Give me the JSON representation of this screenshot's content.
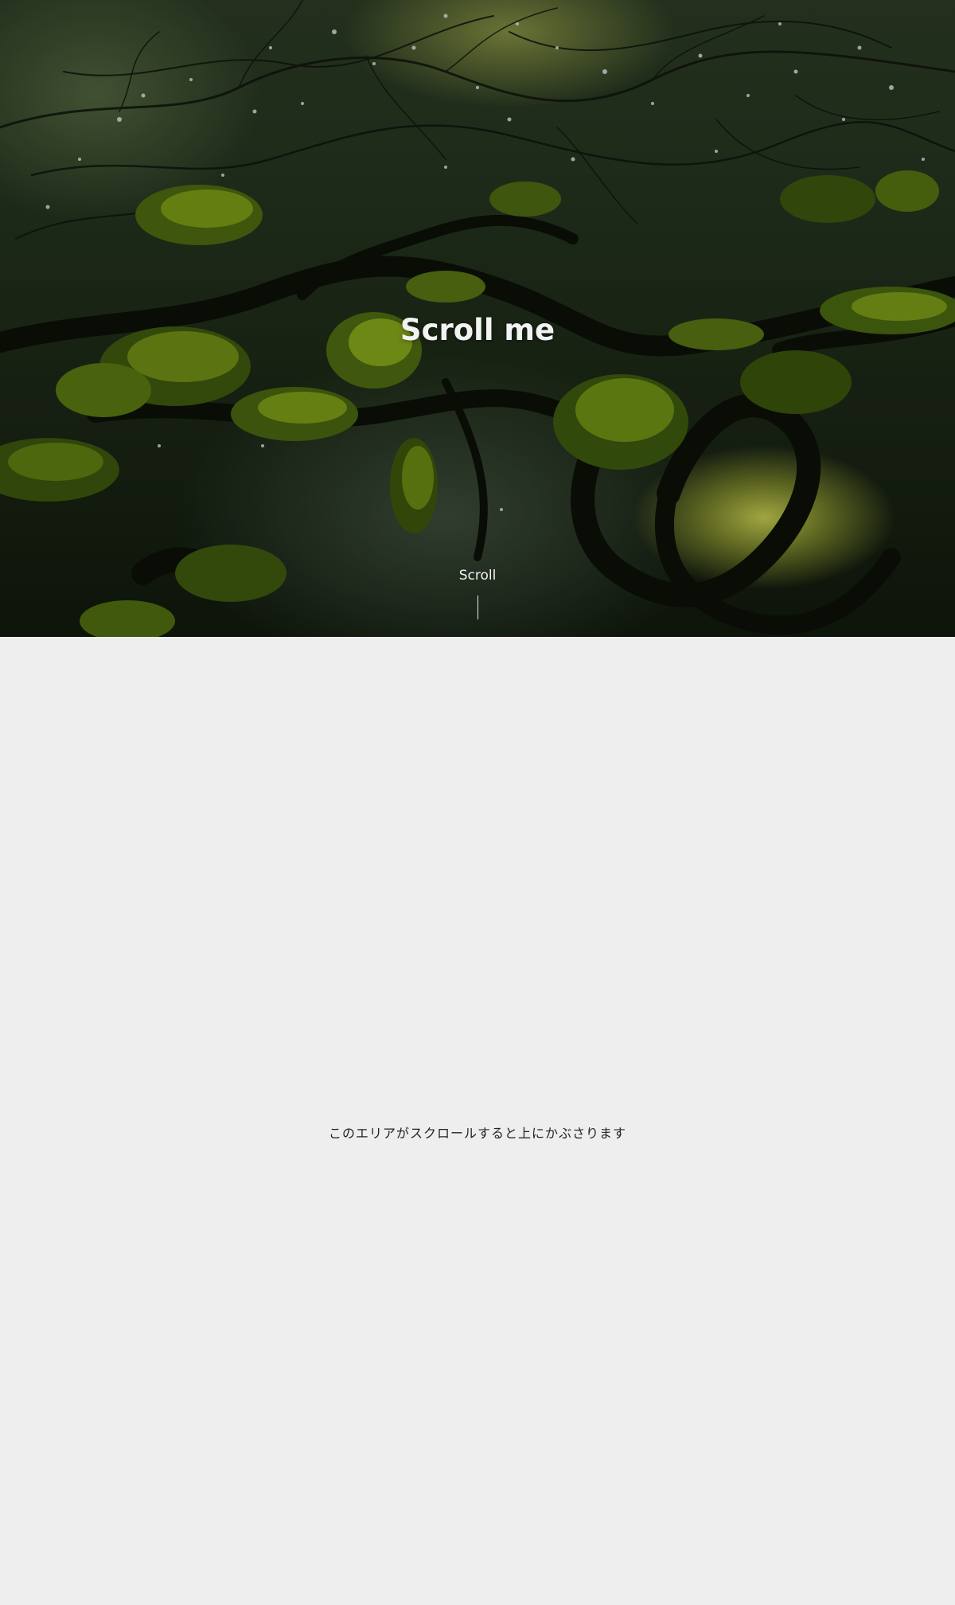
{
  "hero": {
    "title": "Scroll me",
    "scroll_label": "Scroll",
    "background_image": "moss-covered-tree-branches-photo"
  },
  "content": {
    "text": "このエリアがスクロールすると上にかぶさります",
    "background_color": "#eeeeee"
  }
}
